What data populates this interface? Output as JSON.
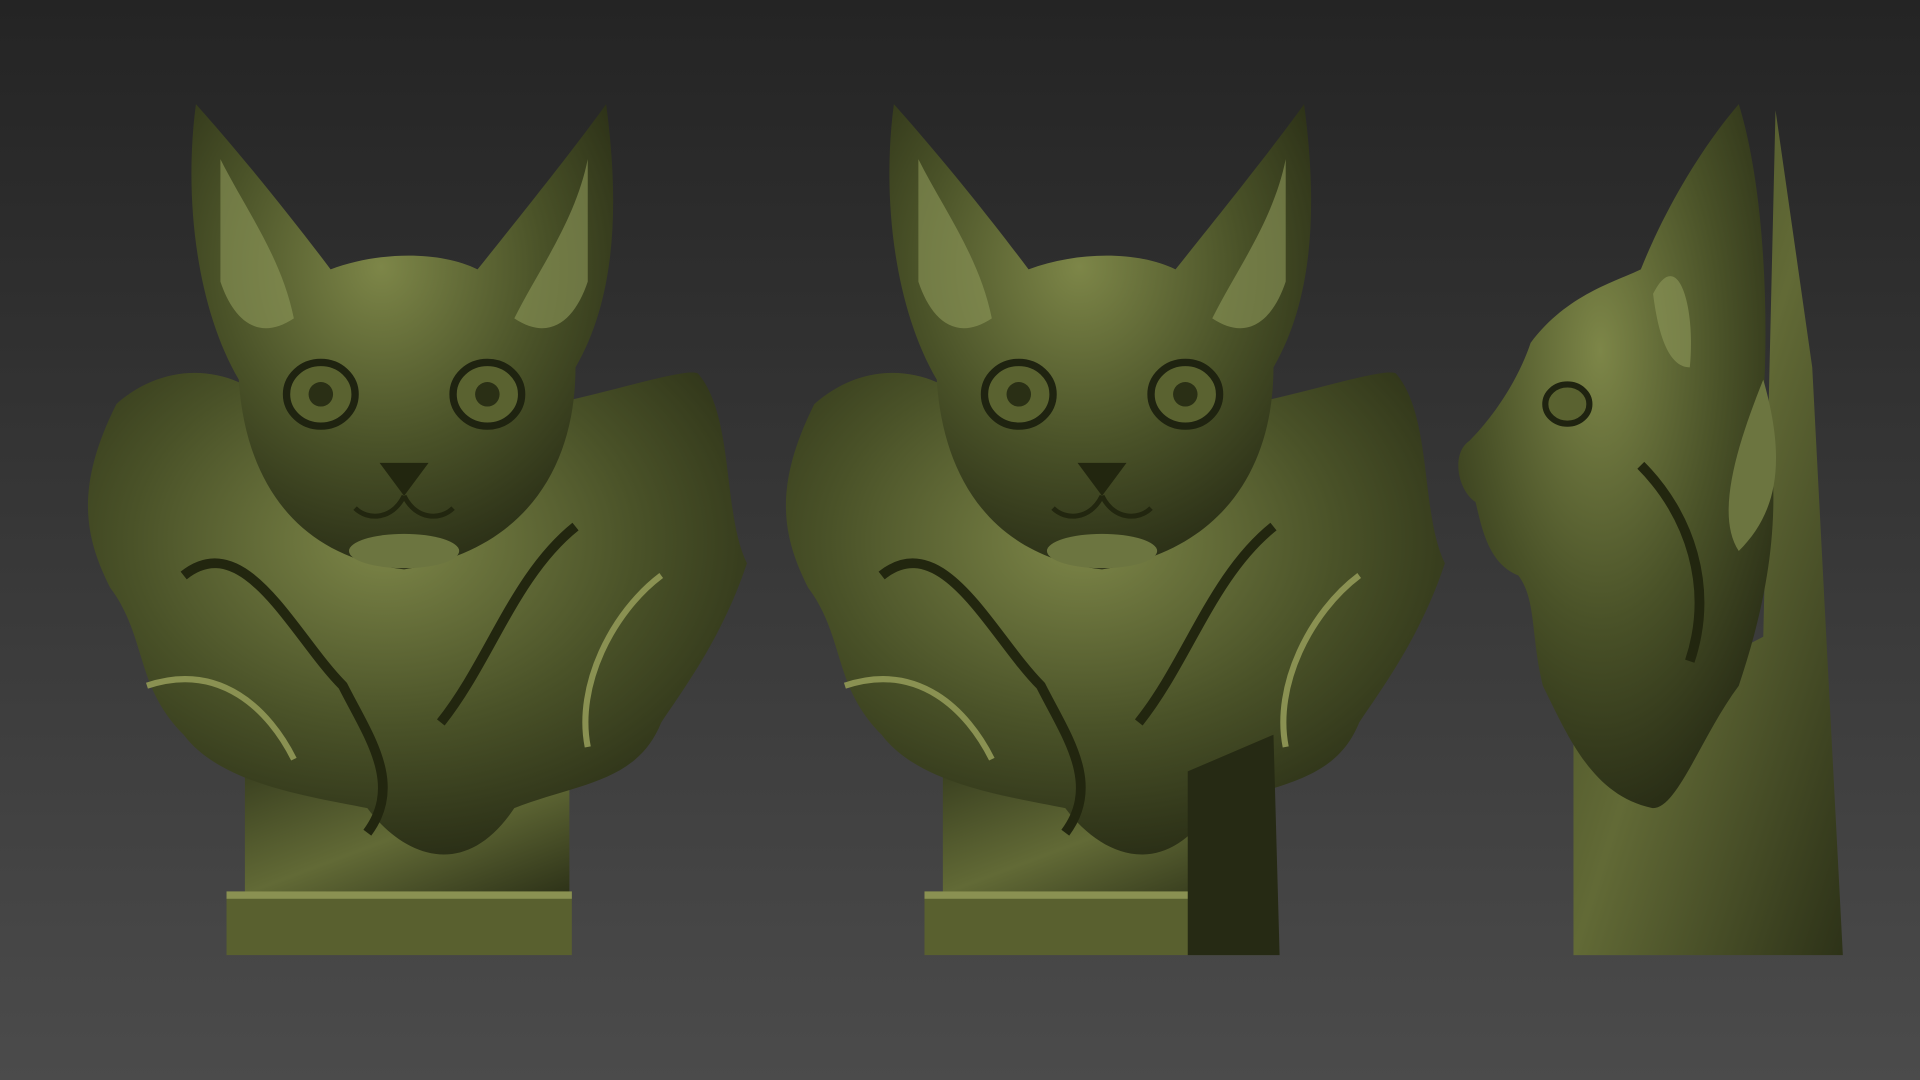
{
  "scene": {
    "views": [
      "front",
      "three-quarter",
      "side"
    ],
    "colors": {
      "background_top": "#252525",
      "background_bottom": "#4a4a4a",
      "sculpture_dark": "#2c3118",
      "sculpture_mid": "#4a5228",
      "sculpture_light": "#7d8648",
      "sculpture_highlight": "#a6ae68"
    }
  }
}
